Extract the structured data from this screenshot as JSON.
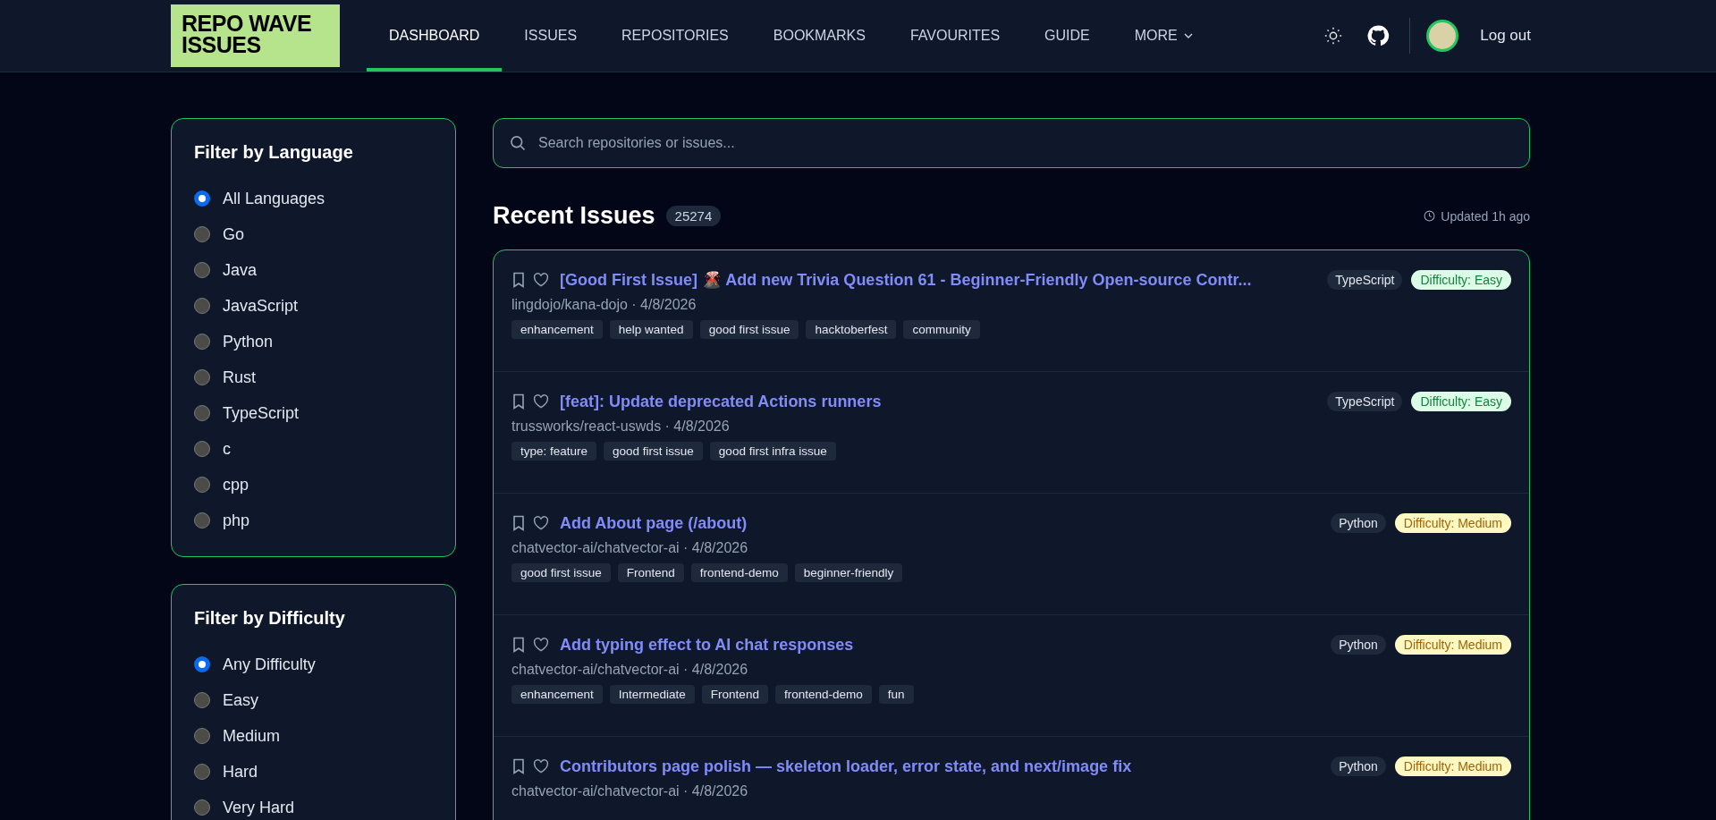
{
  "header": {
    "logo": "REPO WAVE ISSUES",
    "nav": [
      {
        "label": "DASHBOARD",
        "selected": true
      },
      {
        "label": "ISSUES",
        "selected": false
      },
      {
        "label": "REPOSITORIES",
        "selected": false
      },
      {
        "label": "BOOKMARKS",
        "selected": false
      },
      {
        "label": "FAVOURITES",
        "selected": false
      },
      {
        "label": "GUIDE",
        "selected": false
      },
      {
        "label": "MORE",
        "selected": false,
        "kind": "dropdown"
      }
    ],
    "logout": "Log out"
  },
  "filters": [
    {
      "title": "Filter by Language",
      "options": [
        {
          "label": "All Languages",
          "selected": true
        },
        {
          "label": "Go",
          "selected": false
        },
        {
          "label": "Java",
          "selected": false
        },
        {
          "label": "JavaScript",
          "selected": false
        },
        {
          "label": "Python",
          "selected": false
        },
        {
          "label": "Rust",
          "selected": false
        },
        {
          "label": "TypeScript",
          "selected": false
        },
        {
          "label": "c",
          "selected": false
        },
        {
          "label": "cpp",
          "selected": false
        },
        {
          "label": "php",
          "selected": false
        }
      ]
    },
    {
      "title": "Filter by Difficulty",
      "options": [
        {
          "label": "Any Difficulty",
          "selected": true
        },
        {
          "label": "Easy",
          "selected": false
        },
        {
          "label": "Medium",
          "selected": false
        },
        {
          "label": "Hard",
          "selected": false
        },
        {
          "label": "Very Hard",
          "selected": false
        }
      ]
    }
  ],
  "search": {
    "placeholder": "Search repositories or issues..."
  },
  "recent": {
    "title": "Recent Issues",
    "count": "25274",
    "updated": "Updated 1h ago"
  },
  "issues": [
    {
      "title": "[Good First Issue] 🌋 Add new Trivia Question 61 - Beginner-Friendly Open-source Contr...",
      "meta": "lingdojo/kana-dojo · 4/8/2026",
      "language": "TypeScript",
      "difficulty": "Difficulty: Easy",
      "kind": "easy",
      "tags": [
        "enhancement",
        "help wanted",
        "good first issue",
        "hacktoberfest",
        "community"
      ]
    },
    {
      "title": "[feat]: Update deprecated Actions runners",
      "meta": "trussworks/react-uswds · 4/8/2026",
      "language": "TypeScript",
      "difficulty": "Difficulty: Easy",
      "kind": "easy",
      "tags": [
        "type: feature",
        "good first issue",
        "good first infra issue"
      ]
    },
    {
      "title": "Add About page (/about)",
      "meta": "chatvector-ai/chatvector-ai · 4/8/2026",
      "language": "Python",
      "difficulty": "Difficulty: Medium",
      "kind": "medium",
      "tags": [
        "good first issue",
        "Frontend",
        "frontend-demo",
        "beginner-friendly"
      ]
    },
    {
      "title": "Add typing effect to AI chat responses",
      "meta": "chatvector-ai/chatvector-ai · 4/8/2026",
      "language": "Python",
      "difficulty": "Difficulty: Medium",
      "kind": "medium",
      "tags": [
        "enhancement",
        "Intermediate",
        "Frontend",
        "frontend-demo",
        "fun"
      ]
    },
    {
      "title": "Contributors page polish — skeleton loader, error state, and next/image fix",
      "meta": "chatvector-ai/chatvector-ai · 4/8/2026",
      "language": "Python",
      "difficulty": "Difficulty: Medium",
      "kind": "medium"
    }
  ]
}
